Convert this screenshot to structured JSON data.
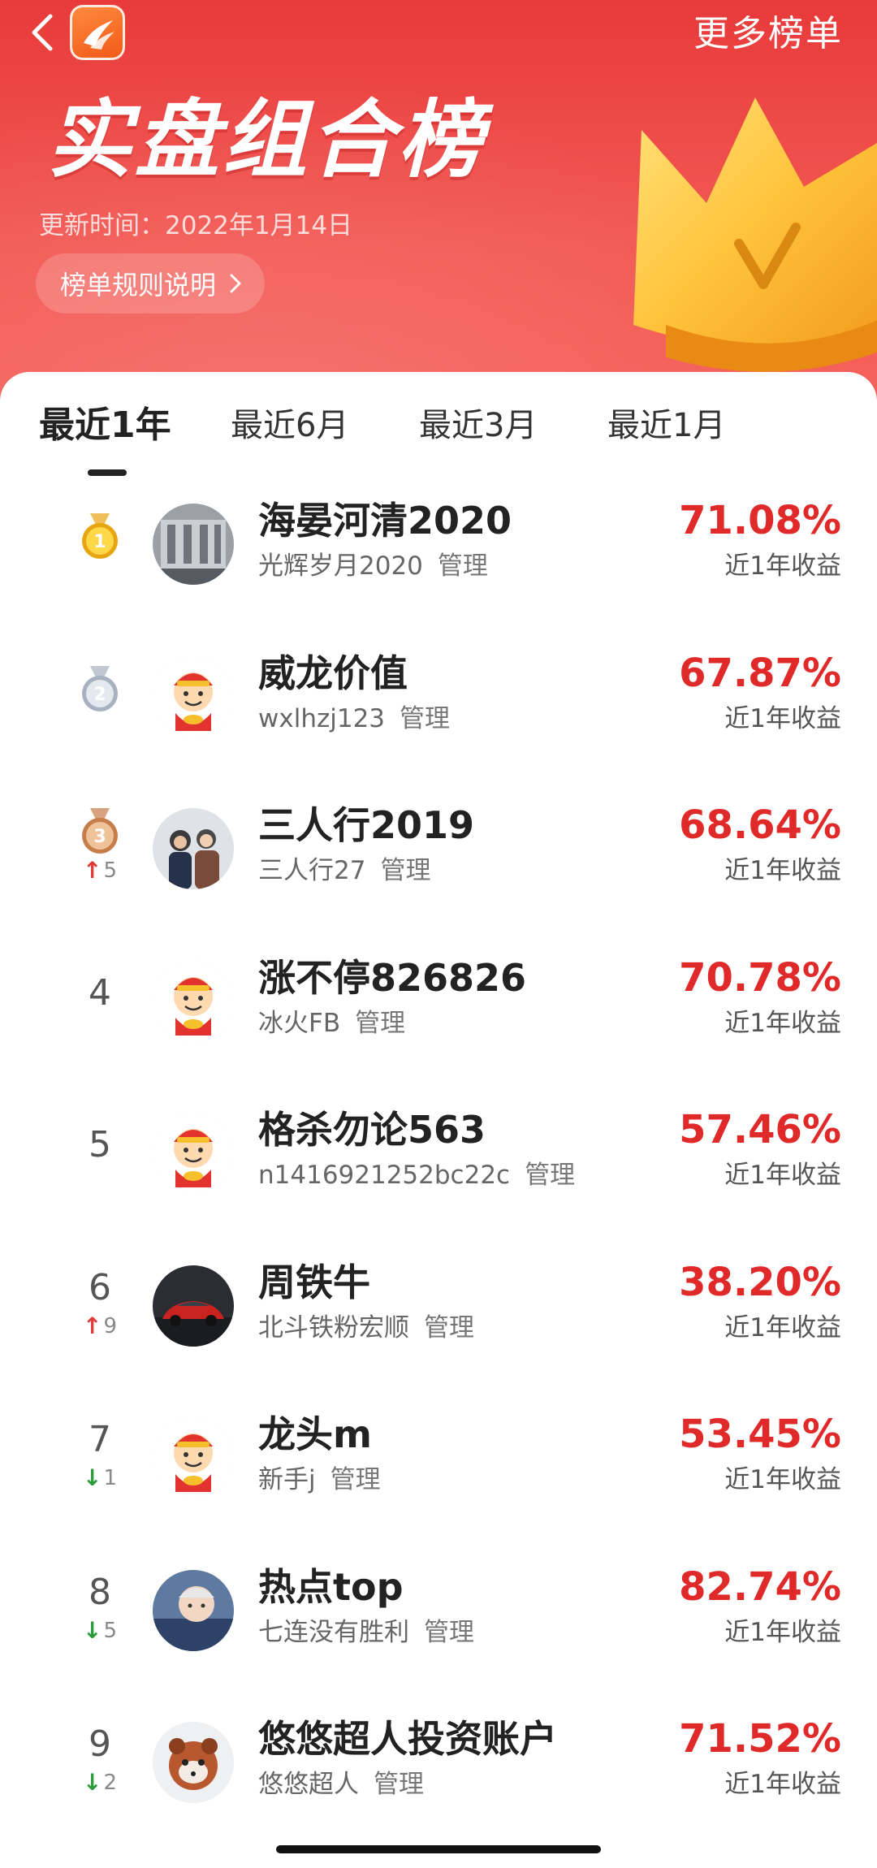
{
  "header": {
    "title": "实盘组合榜",
    "more_label": "更多榜单",
    "update_time": "更新时间：2022年1月14日",
    "rules_label": "榜单规则说明"
  },
  "tabs": [
    {
      "label": "最近1年",
      "active": true
    },
    {
      "label": "最近6月",
      "active": false
    },
    {
      "label": "最近3月",
      "active": false
    },
    {
      "label": "最近1月",
      "active": false
    }
  ],
  "rows": [
    {
      "rank": "1",
      "medal": "gold",
      "move": "",
      "name": "海晏河清2020",
      "owner": "光辉岁月2020",
      "manage": "管理",
      "return": "71.08%",
      "return_label": "近1年收益",
      "avatar": "photo-building"
    },
    {
      "rank": "2",
      "medal": "silver",
      "move": "",
      "name": "威龙价值",
      "owner": "wxlhzj123",
      "manage": "管理",
      "return": "67.87%",
      "return_label": "近1年收益",
      "avatar": "mascot"
    },
    {
      "rank": "3",
      "medal": "bronze",
      "move": "5",
      "move_dir": "up",
      "name": "三人行2019",
      "owner": "三人行27",
      "manage": "管理",
      "return": "68.64%",
      "return_label": "近1年收益",
      "avatar": "photo-people"
    },
    {
      "rank": "4",
      "medal": "",
      "move": "",
      "name": "涨不停826826",
      "owner": "冰火FB",
      "manage": "管理",
      "return": "70.78%",
      "return_label": "近1年收益",
      "avatar": "mascot"
    },
    {
      "rank": "5",
      "medal": "",
      "move": "",
      "name": "格杀勿论563",
      "owner": "n1416921252bc22c",
      "manage": "管理",
      "return": "57.46%",
      "return_label": "近1年收益",
      "avatar": "mascot"
    },
    {
      "rank": "6",
      "medal": "",
      "move": "9",
      "move_dir": "up",
      "name": "周铁牛",
      "owner": "北斗铁粉宏顺",
      "manage": "管理",
      "return": "38.20%",
      "return_label": "近1年收益",
      "avatar": "photo-car"
    },
    {
      "rank": "7",
      "medal": "",
      "move": "1",
      "move_dir": "down",
      "name": "龙头m",
      "owner": "新手j",
      "manage": "管理",
      "return": "53.45%",
      "return_label": "近1年收益",
      "avatar": "mascot"
    },
    {
      "rank": "8",
      "medal": "",
      "move": "5",
      "move_dir": "down",
      "name": "热点top",
      "owner": "七连没有胜利",
      "manage": "管理",
      "return": "82.74%",
      "return_label": "近1年收益",
      "avatar": "photo-baby"
    },
    {
      "rank": "9",
      "medal": "",
      "move": "2",
      "move_dir": "down",
      "name": "悠悠超人投资账户",
      "owner": "悠悠超人",
      "manage": "管理",
      "return": "71.52%",
      "return_label": "近1年收益",
      "avatar": "photo-panda"
    }
  ],
  "colors": {
    "accent": "#e02a2a",
    "header_red": "#e83a3a",
    "up": "#e23a3a",
    "down": "#2a9a3a"
  }
}
